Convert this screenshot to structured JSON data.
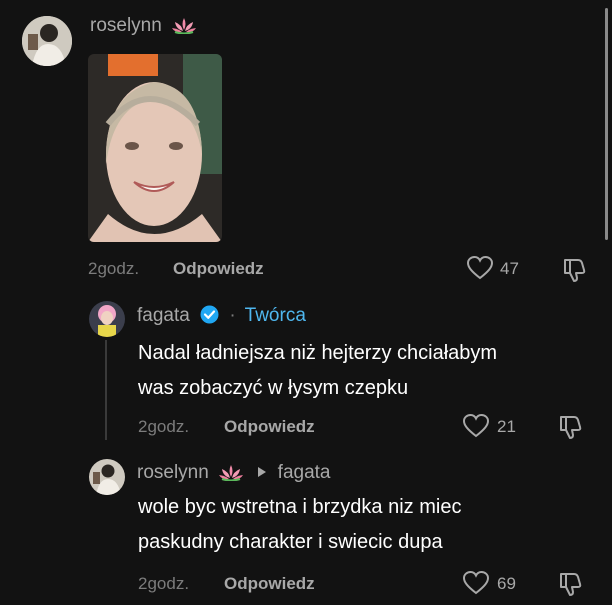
{
  "comments": [
    {
      "username": "roselynn",
      "username_emoji": "lotus-icon",
      "time": "2godz.",
      "reply_label": "Odpowiedz",
      "likes": "47",
      "has_photo": true
    },
    {
      "username": "fagata",
      "verified": true,
      "separator": "·",
      "creator_label": "Twórca",
      "text_line1": "Nadal ładniejsza niż hejterzy chciałabym",
      "text_line2": "was zobaczyć w łysym czepku",
      "time": "2godz.",
      "reply_label": "Odpowiedz",
      "likes": "21"
    },
    {
      "username": "roselynn",
      "username_emoji": "lotus-icon",
      "reply_to": "fagata",
      "text_line1": "wole byc wstretna i brzydka niz miec",
      "text_line2": "paskudny charakter i swiecic dupa",
      "time": "2godz.",
      "reply_label": "Odpowiedz",
      "likes": "69"
    }
  ],
  "colors": {
    "background": "#121212",
    "verified": "#20a7f3",
    "creator": "#4fb7ef",
    "lotus": "#f08aa8"
  }
}
